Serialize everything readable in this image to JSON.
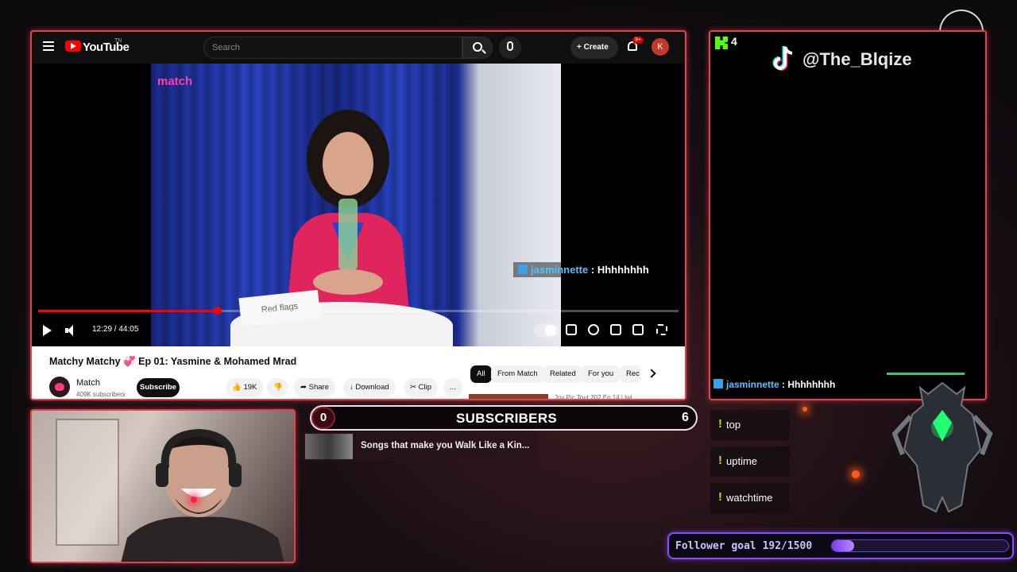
{
  "youtube": {
    "logo_text": "YouTube",
    "logo_superscript": "TN",
    "search_placeholder": "Search",
    "create_label": "Create",
    "notification_badge": "9+",
    "avatar_letter": "K",
    "video": {
      "brand_overlay": "match",
      "card_text": "Red flags",
      "time": "12:29 / 44:05",
      "progress": 0.28
    },
    "title": "Matchy Matchy 💞 Ep 01: Yasmine & Mohamed Mrad",
    "channel": {
      "name": "Match",
      "subscribers": "409K subscribers",
      "subscribe_label": "Subscribe"
    },
    "actions": {
      "likes": "19K",
      "share": "Share",
      "download": "Download",
      "clip": "Clip",
      "more": "..."
    },
    "chips": [
      "All",
      "From Match",
      "Related",
      "For you",
      "Rec"
    ],
    "next_video_title": "Joy Pic Tout 202 Ep 14 | lwi..."
  },
  "overlay_chat": {
    "user": "jasminnette",
    "separator": " : ",
    "message": "Hhhhhhhh"
  },
  "tiktok": {
    "kick_count": "4",
    "handle": "@The_Blqize"
  },
  "subscribers": {
    "left_count": "0",
    "label": "SUBSCRIBERS",
    "right_count": "6"
  },
  "song": {
    "title": "Songs that make you Walk Like a Kin..."
  },
  "commands": [
    {
      "bang": "!",
      "label": "top"
    },
    {
      "bang": "!",
      "label": "uptime"
    },
    {
      "bang": "!",
      "label": "watchtime"
    }
  ],
  "follower_goal": {
    "text": "Follower goal 192/1500",
    "current": 192,
    "target": 1500
  },
  "colors": {
    "frame_red": "#e2434f",
    "goal_purple": "#8a4bff",
    "kick_green": "#53fc18",
    "chat_blue": "#54c0ff",
    "yt_red": "#ff0000"
  }
}
